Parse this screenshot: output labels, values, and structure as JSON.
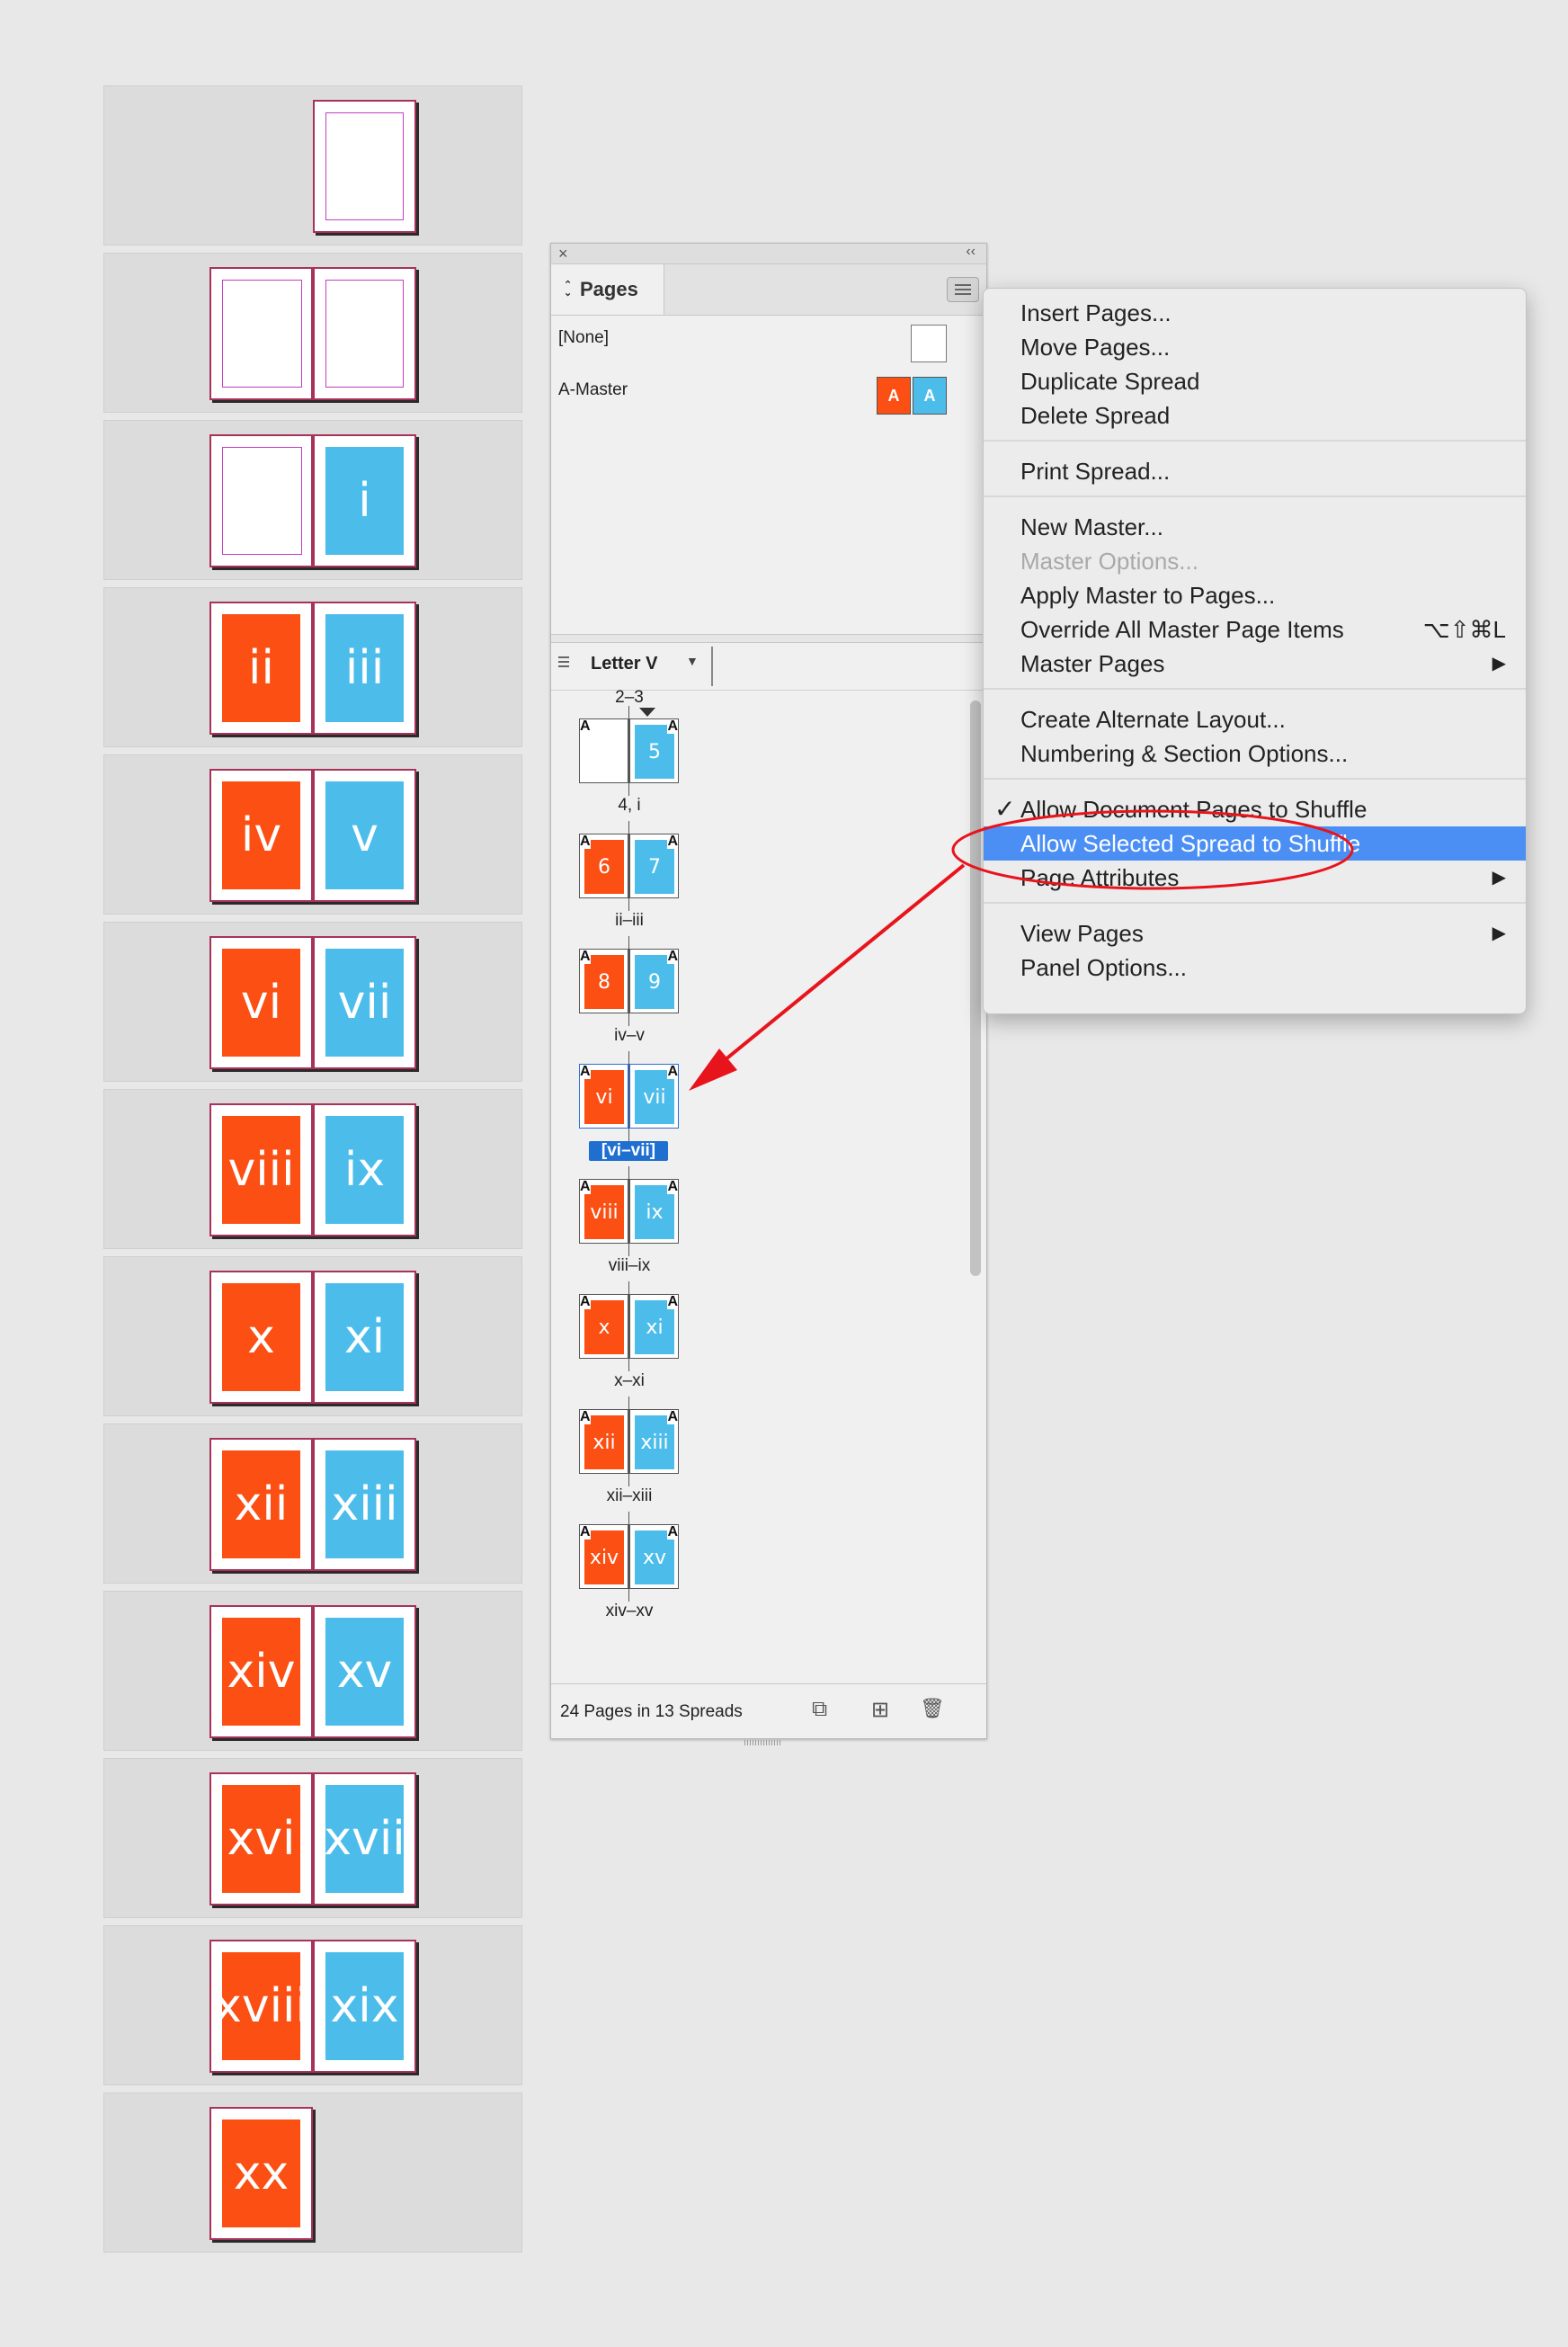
{
  "strip": {
    "rows": [
      {
        "left": null,
        "right": {
          "kind": "blank",
          "label": ""
        }
      },
      {
        "left": {
          "kind": "blank",
          "label": ""
        },
        "right": {
          "kind": "blank",
          "label": ""
        }
      },
      {
        "left": {
          "kind": "blank",
          "label": ""
        },
        "right": {
          "kind": "blue",
          "label": "i"
        }
      },
      {
        "left": {
          "kind": "orange",
          "label": "ii"
        },
        "right": {
          "kind": "blue",
          "label": "iii"
        }
      },
      {
        "left": {
          "kind": "orange",
          "label": "iv"
        },
        "right": {
          "kind": "blue",
          "label": "v"
        }
      },
      {
        "left": {
          "kind": "orange",
          "label": "vi"
        },
        "right": {
          "kind": "blue",
          "label": "vii"
        }
      },
      {
        "left": {
          "kind": "orange",
          "label": "viii"
        },
        "right": {
          "kind": "blue",
          "label": "ix"
        }
      },
      {
        "left": {
          "kind": "orange",
          "label": "x"
        },
        "right": {
          "kind": "blue",
          "label": "xi"
        }
      },
      {
        "left": {
          "kind": "orange",
          "label": "xii"
        },
        "right": {
          "kind": "blue",
          "label": "xiii"
        }
      },
      {
        "left": {
          "kind": "orange",
          "label": "xiv"
        },
        "right": {
          "kind": "blue",
          "label": "xv"
        }
      },
      {
        "left": {
          "kind": "orange",
          "label": "xvi"
        },
        "right": {
          "kind": "blue",
          "label": "xvii"
        }
      },
      {
        "left": {
          "kind": "orange",
          "label": "xviii"
        },
        "right": {
          "kind": "blue",
          "label": "xix"
        }
      },
      {
        "left": {
          "kind": "orange",
          "label": "xx"
        },
        "right": null
      }
    ]
  },
  "panel": {
    "close_glyph": "×",
    "collapse_glyph": "‹‹",
    "tab_label": "Pages",
    "tab_arrows": "⌃⌄",
    "masters": {
      "none_label": "[None]",
      "a_master_label": "A-Master",
      "a_left": "A",
      "a_right": "A"
    },
    "layout_name": "Letter V",
    "layout_caret": "▼",
    "spreads": [
      {
        "top_label": "2–3",
        "left": {
          "kind": "blank",
          "num": "",
          "prefix": "A"
        },
        "right": {
          "kind": "blue",
          "num": "5",
          "prefix": "A"
        },
        "bottom_label": "4, i",
        "selected": false
      },
      {
        "top_label": "",
        "left": {
          "kind": "orange",
          "num": "6",
          "prefix": "A"
        },
        "right": {
          "kind": "blue",
          "num": "7",
          "prefix": "A"
        },
        "bottom_label": "ii–iii",
        "selected": false
      },
      {
        "top_label": "",
        "left": {
          "kind": "orange",
          "num": "8",
          "prefix": "A"
        },
        "right": {
          "kind": "blue",
          "num": "9",
          "prefix": "A"
        },
        "bottom_label": "iv–v",
        "selected": false
      },
      {
        "top_label": "",
        "left": {
          "kind": "orange",
          "num": "vi",
          "prefix": "A"
        },
        "right": {
          "kind": "blue",
          "num": "vii",
          "prefix": "A"
        },
        "bottom_label": "[vi–vii]",
        "selected": true
      },
      {
        "top_label": "",
        "left": {
          "kind": "orange",
          "num": "viii",
          "prefix": "A"
        },
        "right": {
          "kind": "blue",
          "num": "ix",
          "prefix": "A"
        },
        "bottom_label": "viii–ix",
        "selected": false
      },
      {
        "top_label": "",
        "left": {
          "kind": "orange",
          "num": "x",
          "prefix": "A"
        },
        "right": {
          "kind": "blue",
          "num": "xi",
          "prefix": "A"
        },
        "bottom_label": "x–xi",
        "selected": false
      },
      {
        "top_label": "",
        "left": {
          "kind": "orange",
          "num": "xii",
          "prefix": "A"
        },
        "right": {
          "kind": "blue",
          "num": "xiii",
          "prefix": "A"
        },
        "bottom_label": "xii–xiii",
        "selected": false
      },
      {
        "top_label": "",
        "left": {
          "kind": "orange",
          "num": "xiv",
          "prefix": "A"
        },
        "right": {
          "kind": "blue",
          "num": "xv",
          "prefix": "A"
        },
        "bottom_label": "xiv–xv",
        "selected": false
      }
    ],
    "footer_status": "24 Pages in 13 Spreads",
    "footer_icons": {
      "edit": "⧉",
      "new": "⊞",
      "delete": "🗑"
    }
  },
  "menu": {
    "groups": [
      [
        {
          "label": "Insert Pages...",
          "shortcut": "",
          "submenu": false,
          "disabled": false,
          "checked": false,
          "highlighted": false
        },
        {
          "label": "Move Pages...",
          "shortcut": "",
          "submenu": false,
          "disabled": false,
          "checked": false,
          "highlighted": false
        },
        {
          "label": "Duplicate Spread",
          "shortcut": "",
          "submenu": false,
          "disabled": false,
          "checked": false,
          "highlighted": false
        },
        {
          "label": "Delete Spread",
          "shortcut": "",
          "submenu": false,
          "disabled": false,
          "checked": false,
          "highlighted": false
        }
      ],
      [
        {
          "label": "Print Spread...",
          "shortcut": "",
          "submenu": false,
          "disabled": false,
          "checked": false,
          "highlighted": false
        }
      ],
      [
        {
          "label": "New Master...",
          "shortcut": "",
          "submenu": false,
          "disabled": false,
          "checked": false,
          "highlighted": false
        },
        {
          "label": "Master Options...",
          "shortcut": "",
          "submenu": false,
          "disabled": true,
          "checked": false,
          "highlighted": false
        },
        {
          "label": "Apply Master to Pages...",
          "shortcut": "",
          "submenu": false,
          "disabled": false,
          "checked": false,
          "highlighted": false
        },
        {
          "label": "Override All Master Page Items",
          "shortcut": "⌥⇧⌘L",
          "submenu": false,
          "disabled": false,
          "checked": false,
          "highlighted": false
        },
        {
          "label": "Master Pages",
          "shortcut": "",
          "submenu": true,
          "disabled": false,
          "checked": false,
          "highlighted": false
        }
      ],
      [
        {
          "label": "Create Alternate Layout...",
          "shortcut": "",
          "submenu": false,
          "disabled": false,
          "checked": false,
          "highlighted": false
        },
        {
          "label": "Numbering & Section Options...",
          "shortcut": "",
          "submenu": false,
          "disabled": false,
          "checked": false,
          "highlighted": false
        }
      ],
      [
        {
          "label": "Allow Document Pages to Shuffle",
          "shortcut": "",
          "submenu": false,
          "disabled": false,
          "checked": true,
          "highlighted": false
        },
        {
          "label": "Allow Selected Spread to Shuffle",
          "shortcut": "",
          "submenu": false,
          "disabled": false,
          "checked": false,
          "highlighted": true
        },
        {
          "label": "Page Attributes",
          "shortcut": "",
          "submenu": true,
          "disabled": false,
          "checked": false,
          "highlighted": false
        }
      ],
      [
        {
          "label": "View Pages",
          "shortcut": "",
          "submenu": true,
          "disabled": false,
          "checked": false,
          "highlighted": false
        },
        {
          "label": "Panel Options...",
          "shortcut": "",
          "submenu": false,
          "disabled": false,
          "checked": false,
          "highlighted": false
        }
      ]
    ],
    "submenu_glyph": "▶",
    "check_glyph": "✓"
  },
  "colors": {
    "orange": "#fb4f14",
    "blue": "#4cbdeb",
    "highlight": "#4b8ff5",
    "annotation_red": "#e8141c"
  }
}
